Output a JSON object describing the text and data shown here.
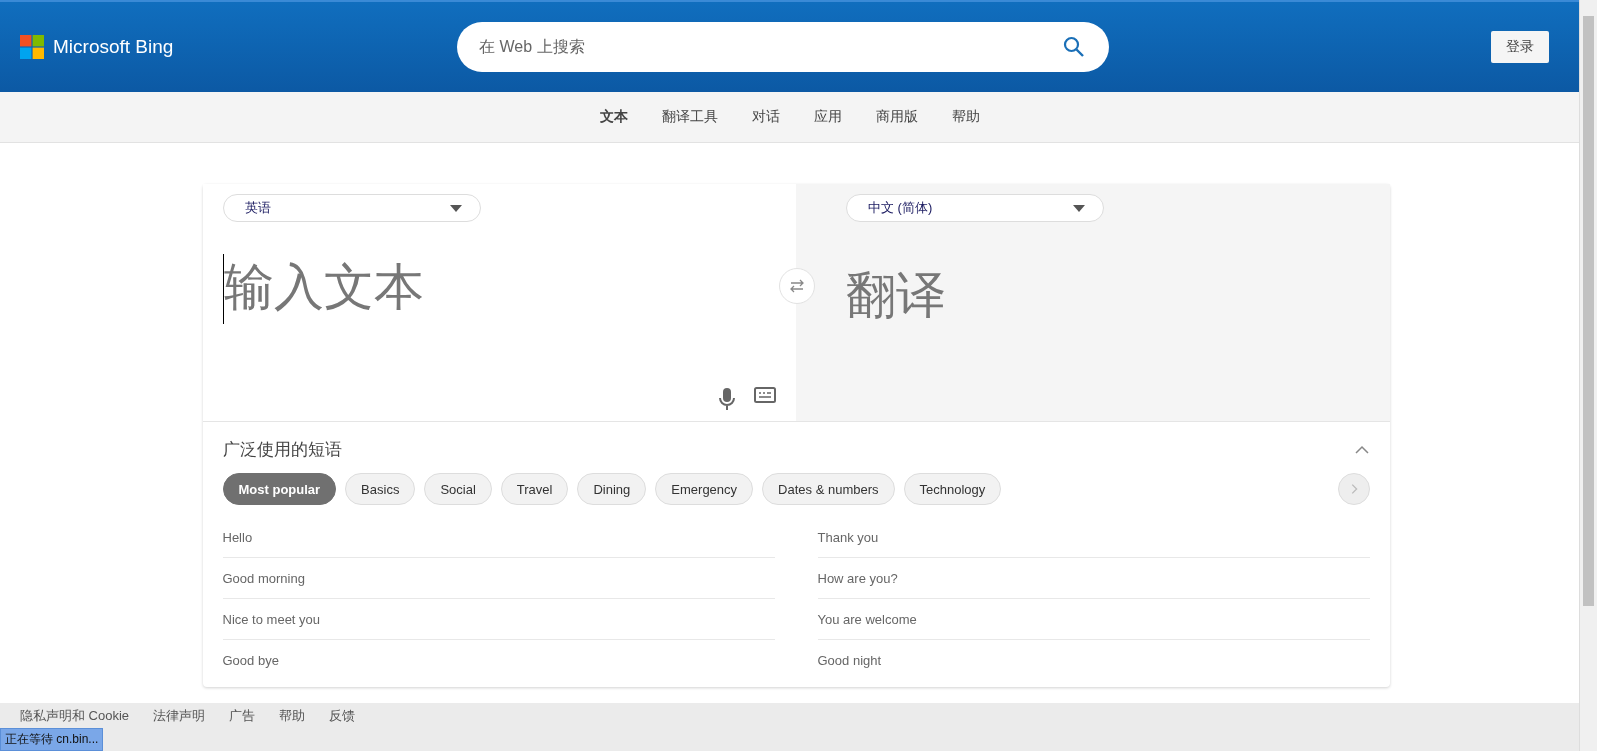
{
  "header": {
    "brand": "Microsoft Bing",
    "search": {
      "placeholder": "在 Web 上搜索"
    },
    "sign_in": "登录"
  },
  "nav": [
    {
      "label": "文本",
      "selected": true
    },
    {
      "label": "翻译工具",
      "selected": false
    },
    {
      "label": "对话",
      "selected": false
    },
    {
      "label": "应用",
      "selected": false
    },
    {
      "label": "商用版",
      "selected": false
    },
    {
      "label": "帮助",
      "selected": false
    }
  ],
  "translator": {
    "source_language": "英语",
    "target_language": "中文 (简体)",
    "input": {
      "placeholder": "输入文本"
    },
    "output_placeholder": "翻译"
  },
  "phrases": {
    "title": "广泛使用的短语",
    "expanded": true,
    "categories": [
      {
        "label": "Most popular",
        "selected": true
      },
      {
        "label": "Basics",
        "selected": false
      },
      {
        "label": "Social",
        "selected": false
      },
      {
        "label": "Travel",
        "selected": false
      },
      {
        "label": "Dining",
        "selected": false
      },
      {
        "label": "Emergency",
        "selected": false
      },
      {
        "label": "Dates & numbers",
        "selected": false
      },
      {
        "label": "Technology",
        "selected": false
      }
    ],
    "items": [
      "Hello",
      "Thank you",
      "Good morning",
      "How are you?",
      "Nice to meet you",
      "You are welcome",
      "Good bye",
      "Good night"
    ]
  },
  "footer": [
    "隐私声明和 Cookie",
    "法律声明",
    "广告",
    "帮助",
    "反馈"
  ],
  "status_bar": "正在等待 cn.bin..."
}
